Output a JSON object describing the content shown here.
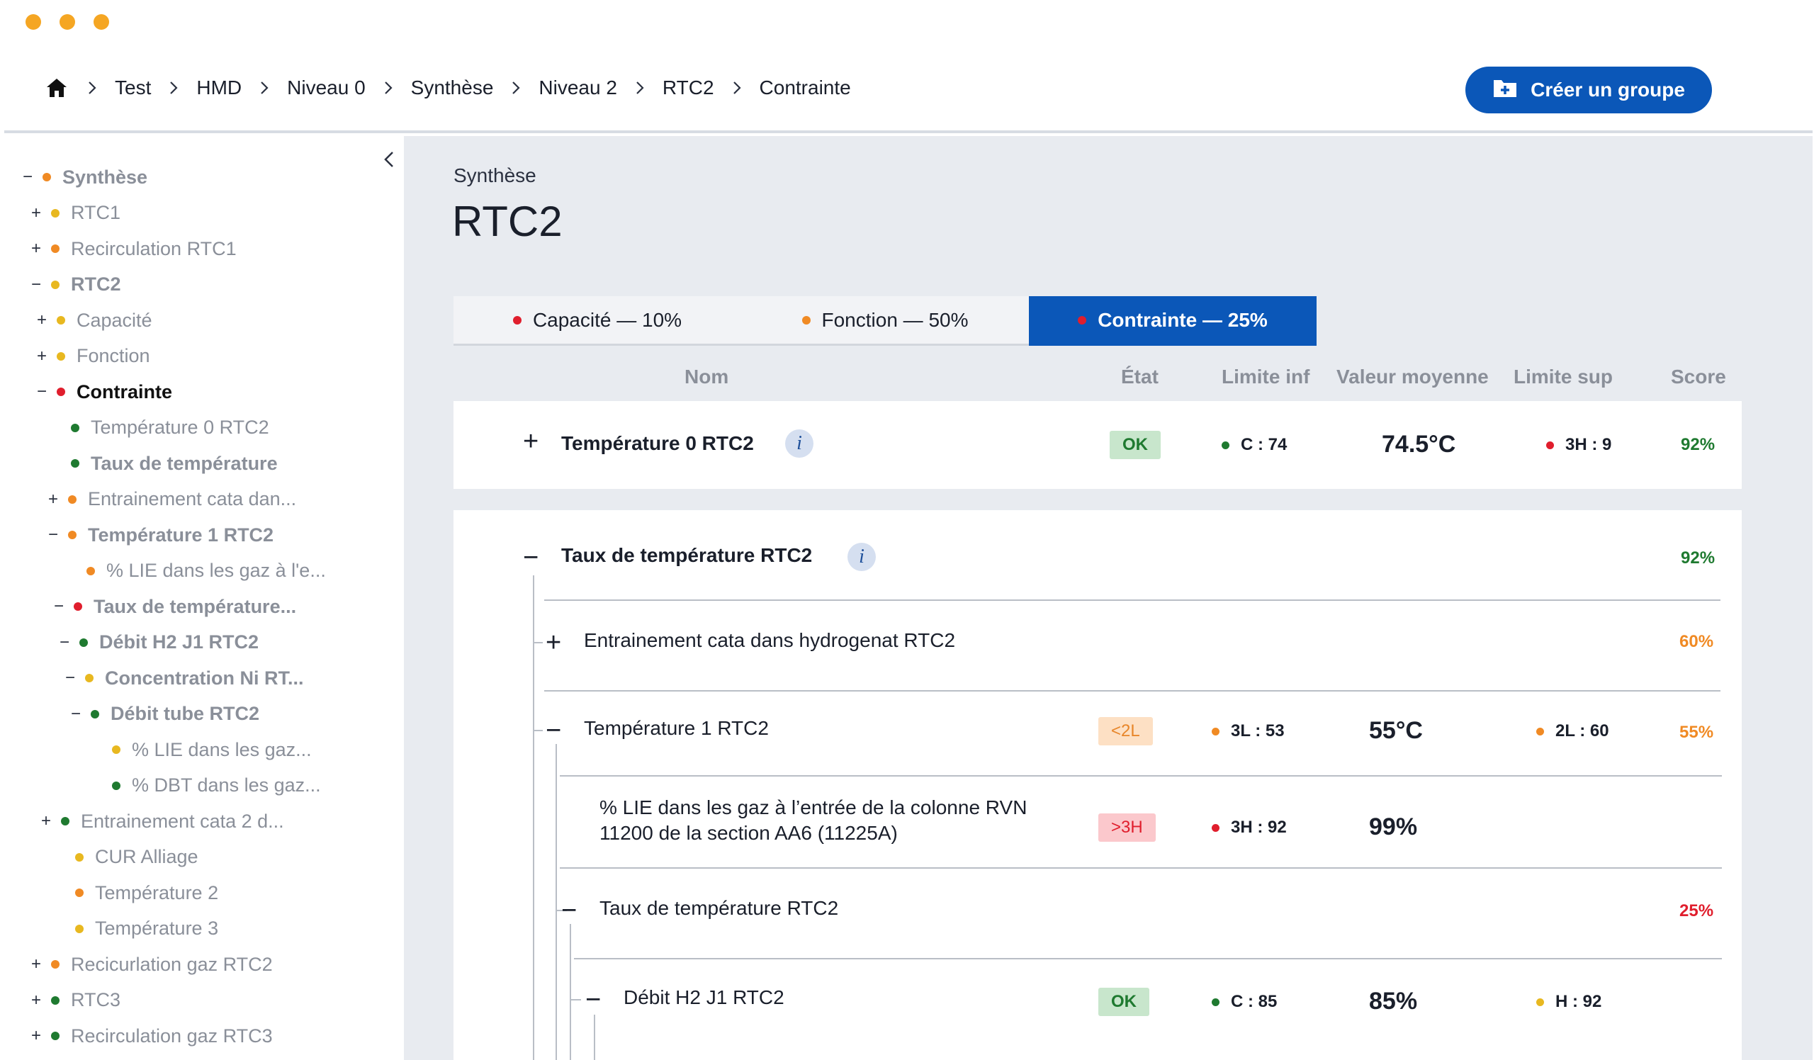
{
  "colors": {
    "accent": "#0b57b8",
    "green": "#1f7a30",
    "orange": "#f08a24",
    "yellow": "#e8b820",
    "red": "#e01e2d"
  },
  "breadcrumb": {
    "home_icon": "home-icon",
    "items": [
      "Test",
      "HMD",
      "Niveau 0",
      "Synthèse",
      "Niveau 2",
      "RTC2",
      "Contrainte"
    ]
  },
  "create_button": {
    "label": "Créer un groupe",
    "icon": "folder-plus-icon"
  },
  "sidebar": {
    "items": [
      {
        "toggle": "−",
        "status": "orange",
        "label": "Synthèse"
      },
      {
        "toggle": "+",
        "status": "yellow",
        "label": "RTC1"
      },
      {
        "toggle": "+",
        "status": "orange",
        "label": "Recirculation RTC1"
      },
      {
        "toggle": "−",
        "status": "yellow",
        "label": "RTC2"
      },
      {
        "toggle": "+",
        "status": "yellow",
        "label": "Capacité"
      },
      {
        "toggle": "+",
        "status": "yellow",
        "label": "Fonction"
      },
      {
        "toggle": "−",
        "status": "red",
        "label": "Contrainte"
      },
      {
        "toggle": "",
        "status": "green",
        "label": "Température 0 RTC2"
      },
      {
        "toggle": "",
        "status": "green",
        "label": "Taux de température"
      },
      {
        "toggle": "+",
        "status": "orange",
        "label": "Entrainement cata dan..."
      },
      {
        "toggle": "−",
        "status": "orange",
        "label": "Température 1 RTC2"
      },
      {
        "toggle": "",
        "status": "orange",
        "label": "% LIE dans les gaz à l'e..."
      },
      {
        "toggle": "−",
        "status": "red",
        "label": "Taux de température..."
      },
      {
        "toggle": "−",
        "status": "green",
        "label": "Débit H2 J1 RTC2"
      },
      {
        "toggle": "−",
        "status": "yellow",
        "label": "Concentration Ni RT..."
      },
      {
        "toggle": "−",
        "status": "green",
        "label": "Débit tube RTC2"
      },
      {
        "toggle": "",
        "status": "yellow",
        "label": "% LIE dans les gaz..."
      },
      {
        "toggle": "",
        "status": "green",
        "label": "% DBT dans les gaz..."
      },
      {
        "toggle": "+",
        "status": "green",
        "label": "Entrainement cata 2 d..."
      },
      {
        "toggle": "",
        "status": "yellow",
        "label": "CUR Alliage"
      },
      {
        "toggle": "",
        "status": "orange",
        "label": "Température 2"
      },
      {
        "toggle": "",
        "status": "yellow",
        "label": "Température 3"
      },
      {
        "toggle": "+",
        "status": "orange",
        "label": "Recicurlation gaz RTC2"
      },
      {
        "toggle": "+",
        "status": "green",
        "label": "RTC3"
      },
      {
        "toggle": "+",
        "status": "green",
        "label": "Recirculation gaz RTC3"
      }
    ]
  },
  "main": {
    "subtitle": "Synthèse",
    "title": "RTC2",
    "tabs": [
      {
        "label": "Capacité — 10%",
        "status": "red"
      },
      {
        "label": "Fonction — 50%",
        "status": "orange"
      },
      {
        "label": "Contrainte — 25%",
        "status": "red"
      }
    ],
    "columns": {
      "name": "Nom",
      "state": "État",
      "lower": "Limite inf",
      "avg": "Valeur moyenne",
      "upper": "Limite sup",
      "score": "Score"
    },
    "rows": {
      "r0": {
        "toggle": "+",
        "name": "Température 0 RTC2",
        "state": "OK",
        "lower": "C : 74",
        "avg": "74.5°C",
        "upper": "3H : 9",
        "score": "92%"
      },
      "r1": {
        "toggle": "−",
        "name": "Taux de température RTC2",
        "score": "92%"
      },
      "r2": {
        "toggle": "+",
        "name": "Entrainement cata dans hydrogenat RTC2",
        "score": "60%"
      },
      "r3": {
        "toggle": "−",
        "name": "Température 1 RTC2",
        "state": "<2L",
        "lower": "3L : 53",
        "avg": "55°C",
        "upper": "2L : 60",
        "score": "55%"
      },
      "r4": {
        "name_line1": "% LIE dans les gaz à l’entrée de la colonne RVN",
        "name_line2": "11200 de la section AA6 (11225A)",
        "state": ">3H",
        "lower": "3H : 92",
        "avg": "99%"
      },
      "r5": {
        "toggle": "−",
        "name": "Taux de température RTC2",
        "score": "25%"
      },
      "r6": {
        "toggle": "−",
        "name": "Débit H2 J1 RTC2",
        "state": "OK",
        "lower": "C : 85",
        "avg": "85%",
        "upper": "H : 92"
      }
    }
  }
}
